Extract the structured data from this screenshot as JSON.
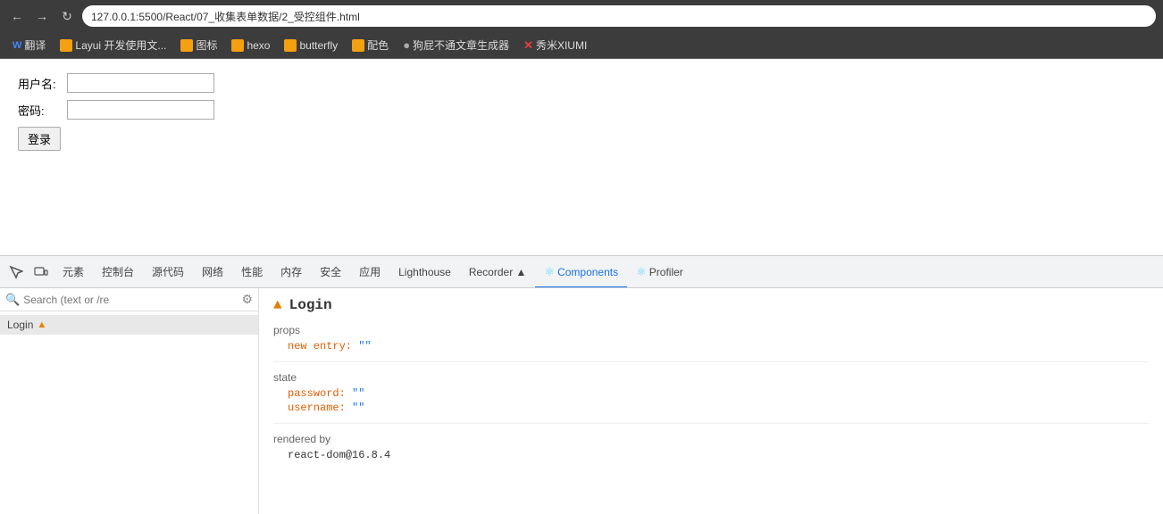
{
  "browser": {
    "nav": {
      "back_label": "←",
      "forward_label": "→",
      "reload_label": "↻",
      "address": "127.0.0.1:5500/React/07_收集表单数据/2_受控组件.html"
    },
    "bookmarks": [
      {
        "id": "translate",
        "label": "翻译",
        "color": "#4285f4",
        "shape": "W"
      },
      {
        "id": "layui",
        "label": "Layui 开发使用文...",
        "color": "#f4a010",
        "shape": "L"
      },
      {
        "id": "icon",
        "label": "图标",
        "color": "#f4a010",
        "shape": "■"
      },
      {
        "id": "hexo",
        "label": "hexo",
        "color": "#f4a010",
        "shape": "■"
      },
      {
        "id": "butterfly",
        "label": "butterfly",
        "color": "#f4a010",
        "shape": "■"
      },
      {
        "id": "palette",
        "label": "配色",
        "color": "#f4a010",
        "shape": "■"
      },
      {
        "id": "dogfart",
        "label": "狗屁不通文章生成器",
        "color": "#aaa",
        "shape": "●"
      },
      {
        "id": "xiumi",
        "label": "秀米XIUMI",
        "color": "#e04040",
        "shape": "✕"
      }
    ]
  },
  "page": {
    "username_label": "用户名:",
    "password_label": "密码:",
    "username_placeholder": "",
    "password_placeholder": "",
    "login_button": "登录"
  },
  "devtools": {
    "tabs": [
      {
        "id": "elements",
        "label": "元素"
      },
      {
        "id": "console",
        "label": "控制台"
      },
      {
        "id": "sources",
        "label": "源代码"
      },
      {
        "id": "network",
        "label": "网络"
      },
      {
        "id": "performance",
        "label": "性能"
      },
      {
        "id": "memory",
        "label": "内存"
      },
      {
        "id": "security",
        "label": "安全"
      },
      {
        "id": "application",
        "label": "应用"
      },
      {
        "id": "lighthouse",
        "label": "Lighthouse"
      },
      {
        "id": "recorder",
        "label": "Recorder ▲"
      },
      {
        "id": "components",
        "label": "Components",
        "active": true
      },
      {
        "id": "profiler",
        "label": "Profiler"
      }
    ],
    "toolbar_icons": [
      {
        "id": "inspect",
        "symbol": "⬚"
      },
      {
        "id": "responsive",
        "symbol": "▭"
      }
    ],
    "left": {
      "search_placeholder": "Search (text or /re",
      "settings_symbol": "⚙",
      "search_symbol": "🔍",
      "component_tree": [
        {
          "label": "Login",
          "warning": true
        }
      ]
    },
    "right": {
      "component_name": "Login",
      "warning_symbol": "▲",
      "props_label": "props",
      "props": [
        {
          "key": "new entry:",
          "value": "\"\""
        }
      ],
      "state_label": "state",
      "state": [
        {
          "key": "password:",
          "value": "\"\""
        },
        {
          "key": "username:",
          "value": "\"\""
        }
      ],
      "rendered_by_label": "rendered by",
      "rendered_by_value": "react-dom@16.8.4"
    }
  }
}
